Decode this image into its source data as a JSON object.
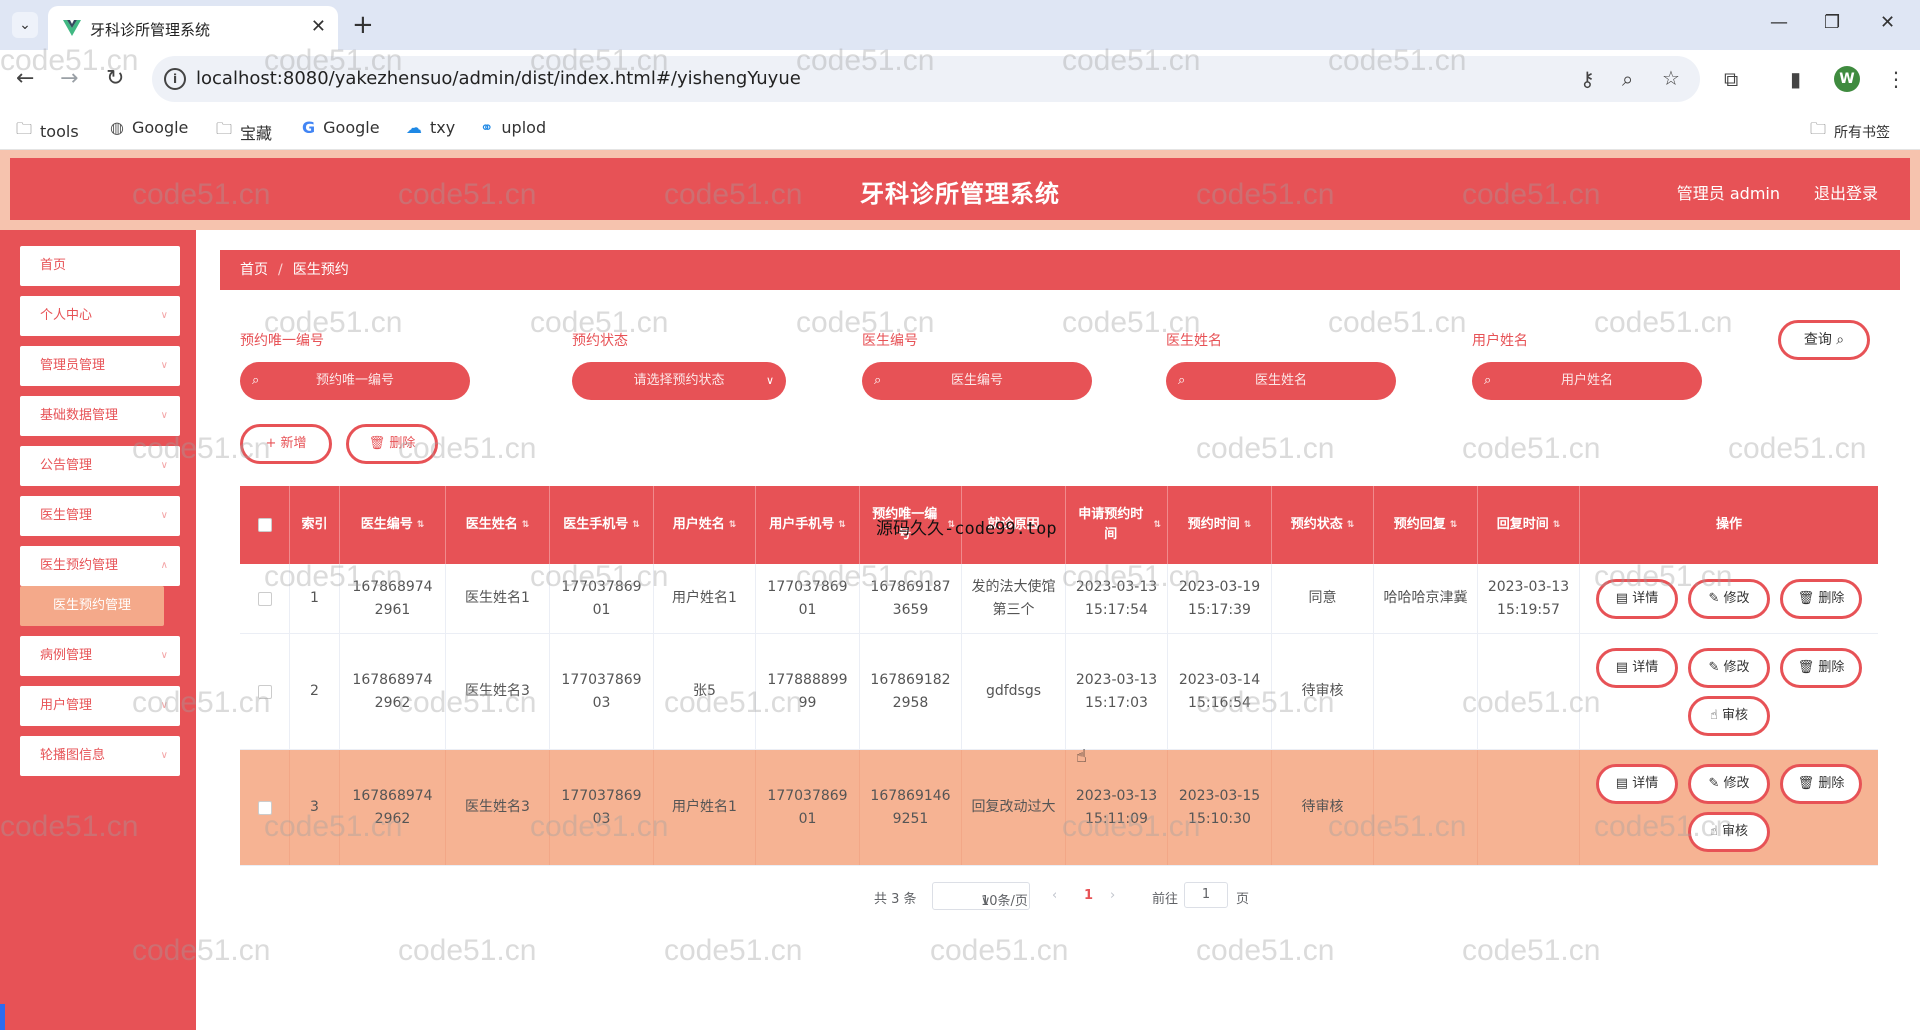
{
  "browser": {
    "tab_title": "牙科诊所管理系统",
    "url": "localhost:8080/yakezhensuo/admin/dist/index.html#/yishengYuyue",
    "profile_initial": "W",
    "bookmarks": [
      "tools",
      "Google",
      "宝藏",
      "Google",
      "txy",
      "uplod"
    ],
    "all_bookmarks": "所有书签"
  },
  "header": {
    "title": "牙科诊所管理系统",
    "admin": "管理员 admin",
    "logout": "退出登录"
  },
  "sidebar": {
    "items": [
      {
        "label": "首页"
      },
      {
        "label": "个人中心"
      },
      {
        "label": "管理员管理"
      },
      {
        "label": "基础数据管理"
      },
      {
        "label": "公告管理"
      },
      {
        "label": "医生管理"
      },
      {
        "label": "医生预约管理"
      },
      {
        "label": "病例管理"
      },
      {
        "label": "用户管理"
      },
      {
        "label": "轮播图信息"
      }
    ],
    "active_sub": "医生预约管理"
  },
  "breadcrumb": {
    "home": "首页",
    "current": "医生预约"
  },
  "search": {
    "fields": [
      {
        "label": "预约唯一编号",
        "placeholder": "预约唯一编号"
      },
      {
        "label": "预约状态",
        "placeholder": "请选择预约状态"
      },
      {
        "label": "医生编号",
        "placeholder": "医生编号"
      },
      {
        "label": "医生姓名",
        "placeholder": "医生姓名"
      },
      {
        "label": "用户姓名",
        "placeholder": "用户姓名"
      }
    ],
    "query_label": "查询"
  },
  "actions": {
    "add": "+ 新增",
    "delete": "删除"
  },
  "table": {
    "columns": [
      "索引",
      "医生编号",
      "医生姓名",
      "医生手机号",
      "用户姓名",
      "用户手机号",
      "预约唯一编号",
      "就诊原因",
      "申请预约时间",
      "预约时间",
      "预约状态",
      "预约回复",
      "回复时间",
      "操作"
    ],
    "rows": [
      {
        "idx": "1",
        "doc_no": "1678689742961",
        "doc_name": "医生姓名1",
        "doc_phone": "17703786901",
        "user_name": "用户姓名1",
        "user_phone": "17703786901",
        "appt_no": "1678691873659",
        "reason": "发的法大使馆第三个",
        "apply_time": "2023-03-13 15:17:54",
        "appt_time": "2023-03-19 15:17:39",
        "status": "同意",
        "reply": "哈哈哈京津冀",
        "reply_time": "2023-03-13 15:19:57"
      },
      {
        "idx": "2",
        "doc_no": "1678689742962",
        "doc_name": "医生姓名3",
        "doc_phone": "17703786903",
        "user_name": "张5",
        "user_phone": "17788889999",
        "appt_no": "1678691822958",
        "reason": "gdfdsgs",
        "apply_time": "2023-03-13 15:17:03",
        "appt_time": "2023-03-14 15:16:54",
        "status": "待审核",
        "reply": "",
        "reply_time": ""
      },
      {
        "idx": "3",
        "doc_no": "1678689742962",
        "doc_name": "医生姓名3",
        "doc_phone": "17703786903",
        "user_name": "用户姓名1",
        "user_phone": "17703786901",
        "appt_no": "1678691469251",
        "reason": "回复改动过大",
        "apply_time": "2023-03-13 15:11:09",
        "appt_time": "2023-03-15 15:10:30",
        "status": "待审核",
        "reply": "",
        "reply_time": ""
      }
    ],
    "op_labels": {
      "detail": "详情",
      "edit": "修改",
      "delete": "删除",
      "audit": "审核"
    }
  },
  "pager": {
    "total": "共 3 条",
    "page_size": "10条/页",
    "page": "1",
    "goto": "前往",
    "goto_value": "1",
    "unit": "页"
  },
  "overlay": "源码久久-code99.top",
  "watermark": "code51.cn",
  "colors": {
    "primary": "#e75256",
    "highlight_row": "#f6b393",
    "header_border": "#f6c3ae"
  }
}
